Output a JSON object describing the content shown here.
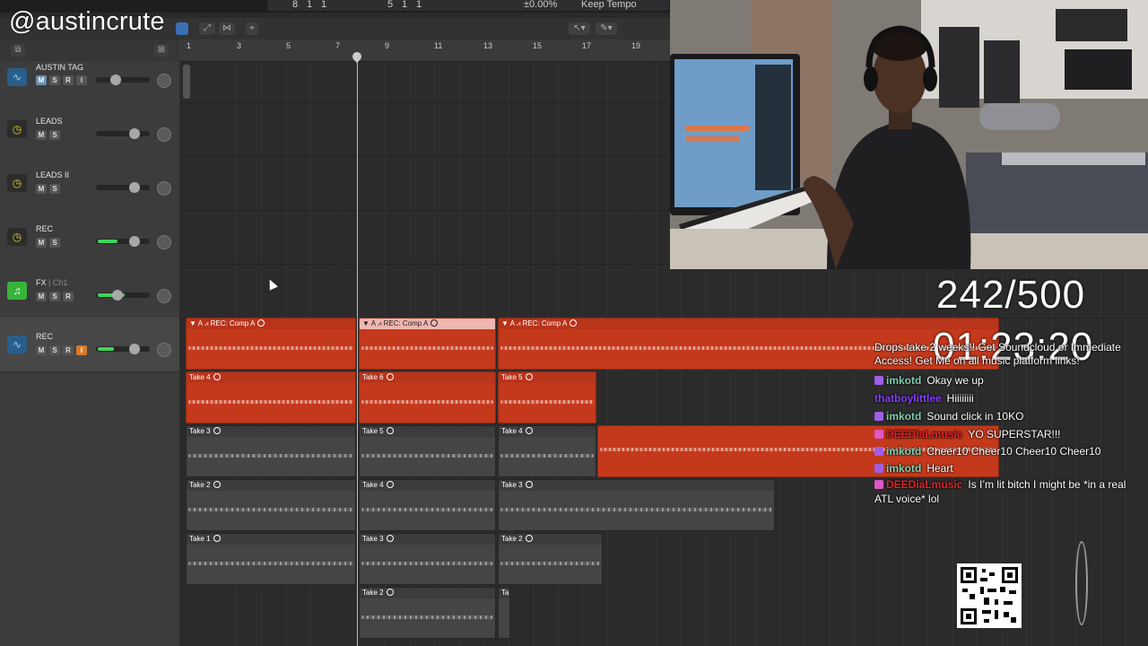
{
  "streamer": {
    "handle": "@austincrute"
  },
  "transport": {
    "bar": "8",
    "beat": "1",
    "div": "1",
    "bar2": "5",
    "beat2": "1",
    "div2": "1",
    "tempo_pct": "±0.00%",
    "tempo_mode": "Keep Tempo"
  },
  "ruler": {
    "bars": [
      "1",
      "3",
      "5",
      "7",
      "9",
      "11",
      "13",
      "15",
      "17",
      "19"
    ]
  },
  "tracks": [
    {
      "name": "AUSTIN TAG",
      "sub": "",
      "buttons": [
        "M",
        "S",
        "R",
        "I"
      ],
      "icon": "waveform-icon",
      "color": "#2a5e8a"
    },
    {
      "name": "LEADS",
      "sub": "",
      "buttons": [
        "M",
        "S"
      ],
      "icon": "clock-icon",
      "color": "#d9c21a"
    },
    {
      "name": "LEADS II",
      "sub": "",
      "buttons": [
        "M",
        "S"
      ],
      "icon": "clock-icon",
      "color": "#d9c21a"
    },
    {
      "name": "REC",
      "sub": "",
      "buttons": [
        "M",
        "S"
      ],
      "icon": "clock-icon",
      "color": "#d9c21a"
    },
    {
      "name": "FX",
      "sub": " | Ch1",
      "buttons": [
        "M",
        "S",
        "R"
      ],
      "icon": "music-note-icon",
      "color": "#37b53a"
    },
    {
      "name": "REC",
      "sub": "",
      "buttons": [
        "M",
        "S",
        "R",
        "I"
      ],
      "icon": "waveform-icon",
      "color": "#2a5e8a"
    }
  ],
  "regions": {
    "comp1": "REC: Comp A",
    "comp2": "REC: Comp A",
    "comp3": "REC: Comp A",
    "r1c1": "Take 4",
    "r1c2": "Take 6",
    "r1c3": "Take 5",
    "r2c1": "Take 3",
    "r2c2": "Take 5",
    "r2c3": "Take 4",
    "r3c1": "Take 2",
    "r3c2": "Take 4",
    "r3c3": "Take 3",
    "r4c1": "Take 1",
    "r4c2": "Take 3",
    "r4c3": "Take 2",
    "r5c2": "Take 2",
    "r5c3": "Ta"
  },
  "overlay": {
    "counter": "242/500",
    "timer": "01:23:20"
  },
  "chat": {
    "top_message": "Drops take 2 weeks!! Get Soundcloud or Immediate Access! Get Me on all music platform links!",
    "messages": [
      {
        "user": "imkotd",
        "text": "Okay we up",
        "user_color": "#7ecfb0",
        "badge": "#a05ee6"
      },
      {
        "user": "thatboylittlee",
        "text": "Hiiiiiiii",
        "user_color": "#8a3cff",
        "badge": ""
      },
      {
        "user": "imkotd",
        "text": "Sound click in 10KO",
        "user_color": "#7ecfb0",
        "badge": "#a05ee6"
      },
      {
        "user": "DEEDiaLmusic",
        "text": "YO SUPERSTAR!!!",
        "user_color": "#e0202a",
        "badge": "#e057c7"
      },
      {
        "user": "imkotd",
        "text": "Cheer10 Cheer10 Cheer10 Cheer10",
        "user_color": "#7ecfb0",
        "badge": "#a05ee6"
      },
      {
        "user": "imkotd",
        "text": "Heart",
        "user_color": "#7ecfb0",
        "badge": "#a05ee6"
      },
      {
        "user": "DEEDiaLmusic",
        "text": "Is I’m lit bitch I might be *in a real ATL voice* lol",
        "user_color": "#e0202a",
        "badge": "#e057c7"
      }
    ]
  }
}
